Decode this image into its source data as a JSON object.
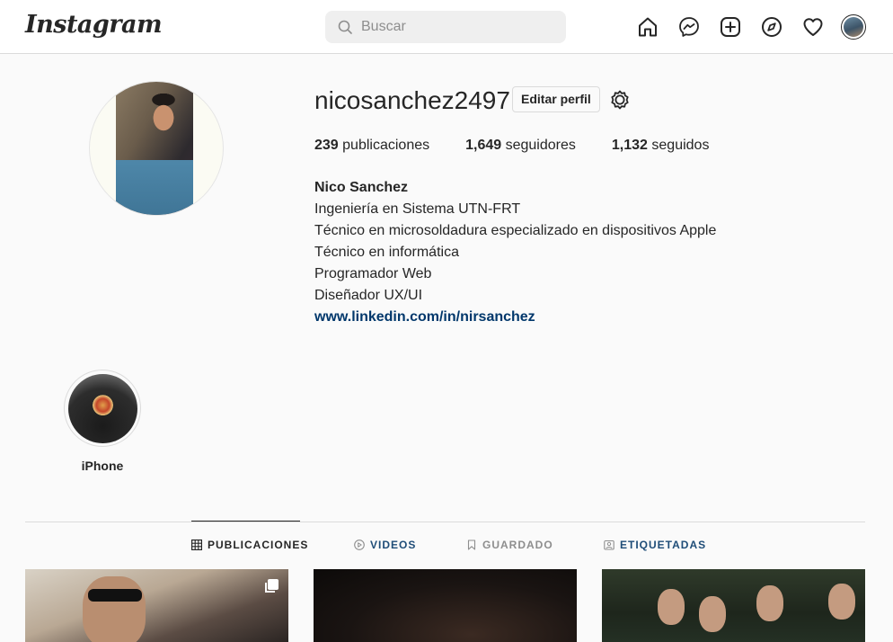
{
  "header": {
    "logo": "Instagram",
    "search_placeholder": "Buscar"
  },
  "nav": {
    "items": [
      "home-icon",
      "messenger-icon",
      "new-post-icon",
      "explore-icon",
      "activity-icon",
      "profile-avatar"
    ]
  },
  "profile": {
    "username": "nicosanchez2497",
    "edit_button": "Editar perfil",
    "stats": [
      {
        "count": "239",
        "label": "publicaciones"
      },
      {
        "count": "1,649",
        "label": "seguidores"
      },
      {
        "count": "1,132",
        "label": "seguidos"
      }
    ],
    "full_name": "Nico Sanchez",
    "bio_lines": [
      "Ingeniería en Sistema UTN-FRT",
      "Técnico en microsoldadura especializado en dispositivos Apple",
      "Técnico en informática",
      "Programador Web",
      "Diseñador UX/UI"
    ],
    "link": "www.linkedin.com/in/nirsanchez"
  },
  "highlights": [
    {
      "label": "iPhone"
    }
  ],
  "tabs": [
    {
      "label": "PUBLICACIONES",
      "icon": "grid-icon",
      "active": true
    },
    {
      "label": "VIDEOS",
      "icon": "play-icon",
      "active": false
    },
    {
      "label": "GUARDADO",
      "icon": "bookmark-icon",
      "active": false
    },
    {
      "label": "ETIQUETADAS",
      "icon": "tagged-icon",
      "active": false
    }
  ],
  "colors": {
    "background": "#fafafa",
    "text": "#262626",
    "muted": "#8e8e8e",
    "link": "#00376b",
    "border": "#dbdbdb"
  }
}
